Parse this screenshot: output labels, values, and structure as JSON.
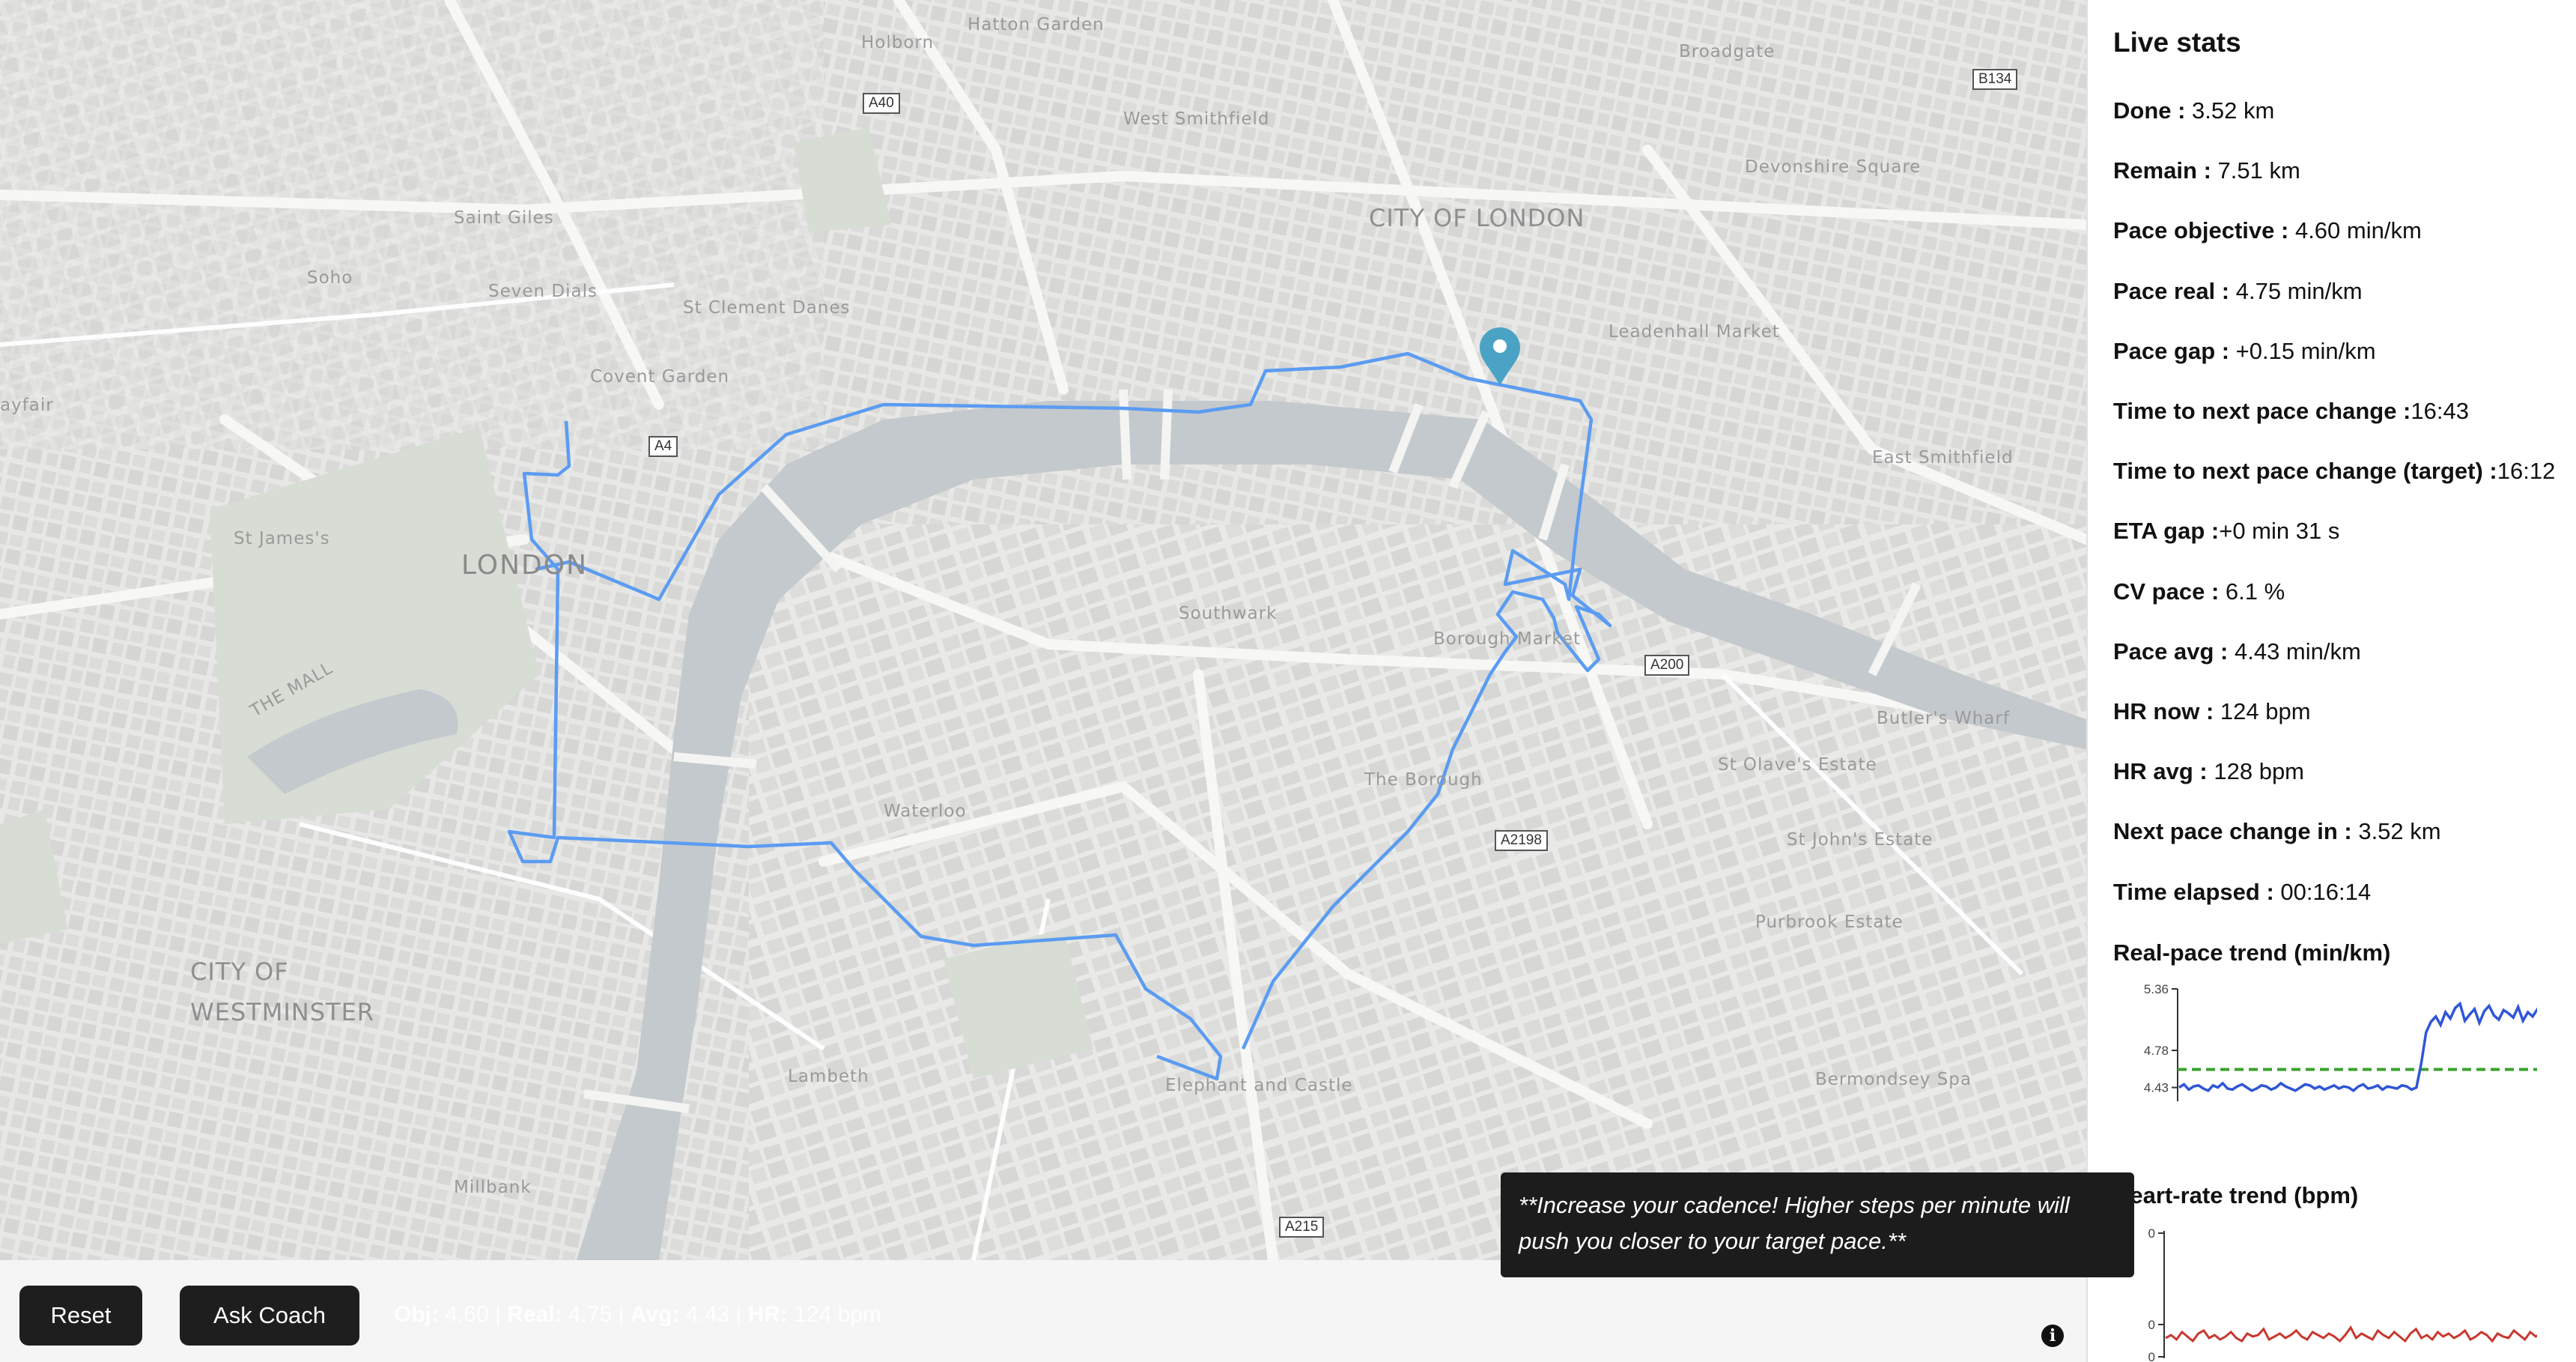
{
  "map": {
    "labels": {
      "holborn": "Holborn",
      "hatton_garden": "Hatton Garden",
      "broadgate": "Broadgate",
      "west_smithfield": "West Smithfield",
      "devonshire_square": "Devonshire Square",
      "saint_giles": "Saint Giles",
      "city_of_london": "CITY OF LONDON",
      "soho": "Soho",
      "seven_dials": "Seven Dials",
      "st_clement_danes": "St Clement Danes",
      "leadenhall_market": "Leadenhall Market",
      "covent_garden": "Covent Garden",
      "mayfair": "ayfair",
      "east_smithfield": "East Smithfield",
      "st_jamess": "St James's",
      "london": "LONDON",
      "southwark": "Southwark",
      "borough_market": "Borough Market",
      "the_mall": "THE MALL",
      "butlers_wharf": "Butler's Wharf",
      "st_olaves_estate": "St Olave's Estate",
      "the_borough": "The Borough",
      "waterloo": "Waterloo",
      "st_johns_estate": "St John's Estate",
      "purbrook_estate": "Purbrook Estate",
      "city_of": "CITY OF",
      "westminster": "WESTMINSTER",
      "lambeth": "Lambeth",
      "elephant_and_castle": "Elephant and Castle",
      "bermondsey_spa": "Bermondsey Spa",
      "millbank": "Millbank"
    },
    "roads": {
      "a40": "A40",
      "b134": "B134",
      "a4": "A4",
      "a200": "A200",
      "a2198": "A2198",
      "a215": "A215"
    },
    "route_color": "#5b9cf2",
    "marker_color": "#4aa3c4",
    "river_color": "#c4c9cd"
  },
  "controls": {
    "reset_label": "Reset",
    "ask_coach_label": "Ask Coach",
    "summary": {
      "obj_label": "Obj:",
      "obj_value": "4.60",
      "real_label": "Real:",
      "real_value": "4.75",
      "avg_label": "Avg:",
      "avg_value": "4.43",
      "hr_label": "HR:",
      "hr_value": "124 bpm",
      "sep": "|"
    }
  },
  "tooltip": {
    "text": "**Increase your cadence! Higher steps per minute will push you closer to your target pace.**"
  },
  "panel": {
    "title": "Live stats",
    "stats": [
      {
        "label": "Done :",
        "value": " 3.52 km"
      },
      {
        "label": "Remain :",
        "value": " 7.51 km"
      },
      {
        "label": "Pace objective :",
        "value": " 4.60 min/km"
      },
      {
        "label": "Pace real :",
        "value": " 4.75 min/km"
      },
      {
        "label": "Pace gap :",
        "value": " +0.15 min/km"
      },
      {
        "label": "Time to next pace change :",
        "value": "16:43"
      },
      {
        "label": "Time to next pace change (target) :",
        "value": "16:12"
      },
      {
        "label": "ETA gap :",
        "value": "+0 min 31 s"
      },
      {
        "label": "CV pace :",
        "value": " 6.1 %"
      },
      {
        "label": "Pace avg :",
        "value": " 4.43 min/km"
      },
      {
        "label": "HR now :",
        "value": " 124 bpm"
      },
      {
        "label": "HR avg :",
        "value": " 128 bpm"
      },
      {
        "label": "Next pace change in :",
        "value": " 3.52 km"
      },
      {
        "label": "Time elapsed :",
        "value": " 00:16:14"
      }
    ],
    "pace_chart_title": "Real-pace trend (min/km)",
    "hr_chart_title": "Heart-rate trend (bpm)"
  },
  "chart_data": [
    {
      "type": "line",
      "title": "Real-pace trend (min/km)",
      "yticks": [
        "5.36",
        "4.78",
        "4.43"
      ],
      "ylim": [
        4.3,
        5.36
      ],
      "target": 4.6,
      "series": [
        {
          "values": [
            4.43,
            4.46,
            4.41,
            4.44,
            4.45,
            4.42,
            4.4,
            4.45,
            4.43,
            4.47,
            4.42,
            4.41,
            4.44,
            4.46,
            4.43,
            4.4,
            4.42,
            4.45,
            4.44,
            4.41,
            4.43,
            4.47,
            4.44,
            4.42,
            4.4,
            4.43,
            4.46,
            4.45,
            4.42,
            4.44,
            4.41,
            4.43,
            4.45,
            4.42,
            4.44,
            4.43,
            4.4,
            4.44,
            4.46,
            4.42,
            4.43,
            4.45,
            4.41,
            4.44,
            4.43,
            4.42,
            4.45,
            4.44,
            4.41,
            4.43,
            4.66,
            4.95,
            5.05,
            5.1,
            5.02,
            5.14,
            5.08,
            5.18,
            5.22,
            5.06,
            5.12,
            5.17,
            5.04,
            5.15,
            5.2,
            5.11,
            5.07,
            5.16,
            5.13,
            5.09,
            5.19,
            5.06,
            5.14,
            5.1,
            5.17,
            5.12,
            5.05,
            4.8
          ]
        }
      ]
    },
    {
      "type": "line",
      "title": "Heart-rate trend (bpm)",
      "yticks": [
        "0",
        "0",
        "0"
      ],
      "series": [
        {
          "values": [
            126,
            128,
            125,
            130,
            127,
            124,
            129,
            131,
            126,
            128,
            125,
            127,
            130,
            126,
            124,
            129,
            127,
            128,
            132,
            125,
            127,
            129,
            126,
            128,
            131,
            127,
            125,
            130,
            128,
            126,
            129,
            127,
            124,
            128,
            133,
            126,
            129,
            127,
            125,
            131,
            128,
            126,
            130,
            127,
            124,
            129,
            132,
            126,
            128,
            125,
            130,
            127,
            129,
            126,
            128,
            131,
            125,
            127,
            130,
            128,
            124,
            129,
            127,
            126,
            131,
            128,
            125,
            130,
            127,
            129,
            126,
            124
          ]
        }
      ]
    }
  ]
}
